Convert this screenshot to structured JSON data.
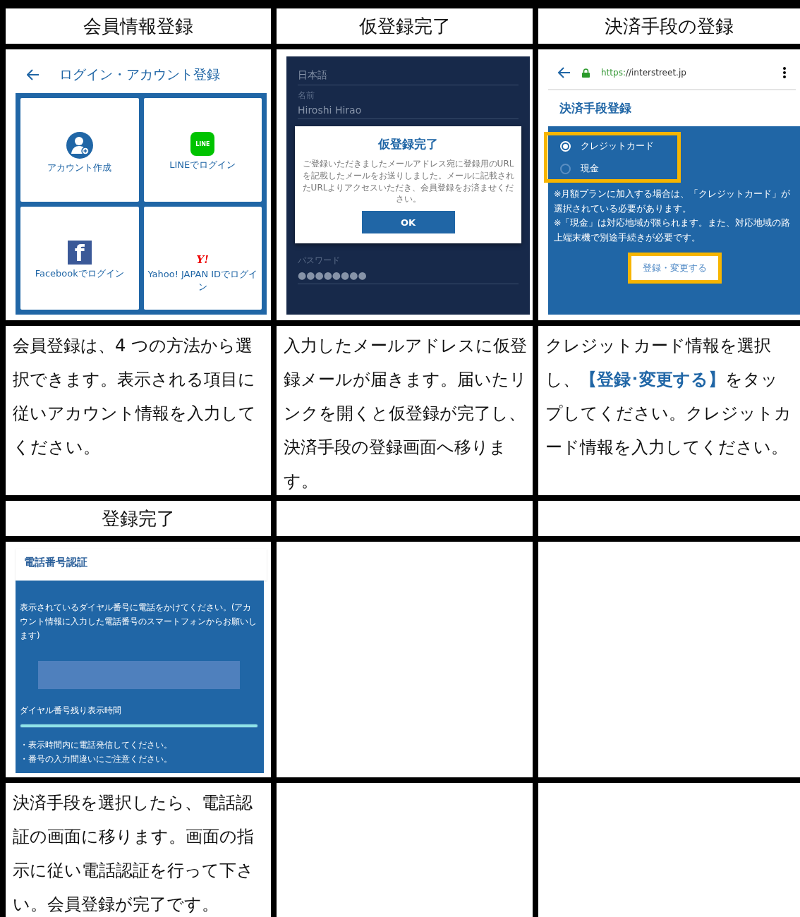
{
  "steps": [
    {
      "header": "会員情報登録",
      "screen": {
        "kind": "login",
        "title": "ログイン・アカウント登録",
        "tiles": [
          {
            "kind": "account",
            "label": "アカウント作成"
          },
          {
            "kind": "line",
            "badge": "LINE",
            "label": "LINEでログイン"
          },
          {
            "kind": "facebook",
            "badge": "f",
            "label": "Facebookでログイン"
          },
          {
            "kind": "yahoo",
            "badge": "Y!",
            "label": "Yahoo! JAPAN IDでログイン"
          }
        ]
      },
      "caption": "会員登録は、4 つの方法から選択できます。表示される項目に従いアカウント情報を入力してください。"
    },
    {
      "header": "仮登録完了",
      "screen": {
        "kind": "dialog",
        "fields_top": [
          {
            "value": "日本語"
          },
          {
            "label": "名前",
            "value": "Hiroshi Hirao"
          }
        ],
        "fields_bottom": [
          {
            "label": "パスワード",
            "value": "●●●●●●●●"
          }
        ],
        "dialog": {
          "title": "仮登録完了",
          "message": "ご登録いただきましたメールアドレス宛に登録用のURLを記載したメールをお送りしました。メールに記載されたURLよりアクセスいただき、会員登録をお済ませください。",
          "button": "OK"
        }
      },
      "caption": "入力したメールアドレスに仮登録メールが届きます。届いたリンクを開くと仮登録が完了し、決済手段の登録画面へ移ります。"
    },
    {
      "header": "決済手段の登録",
      "screen": {
        "kind": "payment",
        "url_scheme": "https:",
        "url_host": "//interstreet.jp",
        "title": "決済手段登録",
        "options": [
          {
            "label": "クレジットカード",
            "selected": true
          },
          {
            "label": "現金",
            "selected": false
          }
        ],
        "notes": [
          "※月額プランに加入する場合は、「クレジットカード」が選択されている必要があります。",
          "※「現金」は対応地域が限られます。また、対応地域の路上端末機で別途手続きが必要です。"
        ],
        "button": "登録・変更する"
      },
      "caption": "クレジットカード情報を選択し、**【登録･変更する】**をタップしてください。クレジットカード情報を入力してください。"
    },
    {
      "header": "登録完了",
      "screen": {
        "kind": "phone",
        "title": "電話番号認証",
        "message": "表示されているダイヤル番号に電話をかけてください。(アカウント情報に入力した電話番号のスマートフォンからお願いします)",
        "timer_label": "ダイヤル番号残り表示時間",
        "level": 1,
        "notes": [
          "・表示時間内に電話発信してください。",
          "・番号の入力間違いにご注意ください。"
        ]
      },
      "caption": "決済手段を選択したら、電話認証の画面に移ります。画面の指示に従い電話認証を行って下さい。会員登録が完了です。"
    }
  ]
}
